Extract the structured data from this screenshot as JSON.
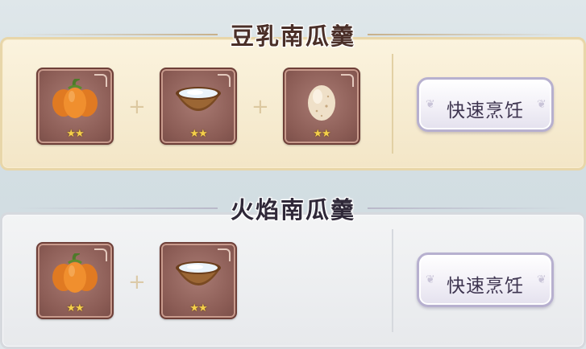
{
  "recipes": [
    {
      "title": "豆乳南瓜羹",
      "ingredients": [
        {
          "icon": "pumpkin-icon",
          "stars": "★★"
        },
        {
          "icon": "coconut-bowl-icon",
          "stars": "★★"
        },
        {
          "icon": "egg-icon",
          "stars": "★★"
        }
      ],
      "plus": "+",
      "button_label": "快速烹饪"
    },
    {
      "title": "火焰南瓜羹",
      "ingredients": [
        {
          "icon": "pumpkin-icon",
          "stars": "★★"
        },
        {
          "icon": "coconut-bowl-icon",
          "stars": "★★"
        }
      ],
      "plus": "+",
      "button_label": "快速烹饪"
    }
  ],
  "colors": {
    "panel_gold": "#f3e6c7",
    "panel_gray": "#e7e9ec",
    "slot_bg": "#8b5c55",
    "star": "#f5d04a",
    "button_text": "#3e3550"
  }
}
